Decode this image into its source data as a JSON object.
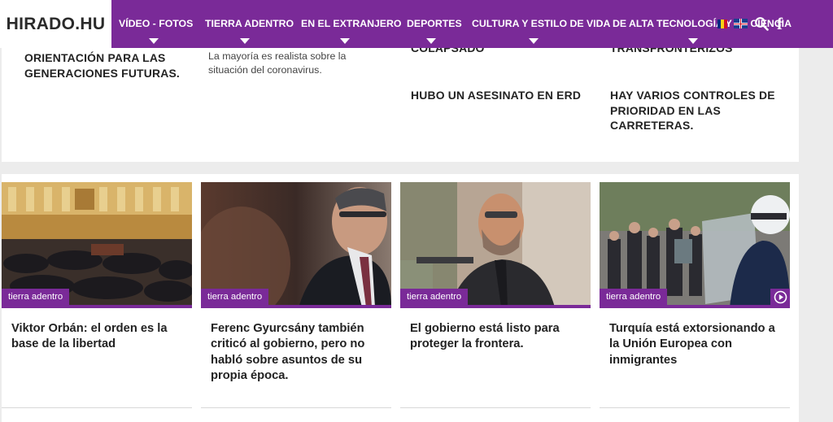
{
  "header": {
    "logo": "HIRADO.HU",
    "nav": [
      {
        "label": "VÍDEO - FOTOS"
      },
      {
        "label": "TIERRA ADENTRO"
      },
      {
        "label": "EN EL EXTRANJERO"
      },
      {
        "label": "DEPORTES"
      },
      {
        "label": "CULTURA Y ESTILO DE VIDA"
      },
      {
        "label": "DE ALTA TECNOLOGÍA Y LA CIENCIA"
      }
    ],
    "icons": [
      "flag-romania-icon",
      "flag-uk-icon",
      "search-icon",
      "facebook-icon"
    ],
    "colors": {
      "brand": "#7a2a98",
      "logo_bg": "#ffffff"
    }
  },
  "top": {
    "col1_title": "ORIENTACIÓN PARA LAS GENERACIONES FUTURAS.",
    "col2_sub": "La mayoría es realista sobre la situación del coronavirus.",
    "col3_cut": "COLAPSADO",
    "col3_title": "HUBO UN ASESINATO EN ERD",
    "col4_cut": "TRANSFRONTERIZOS",
    "col4_title": "HAY VARIOS CONTROLES DE PRIORIDAD EN LAS CARRETERAS."
  },
  "cards": [
    {
      "tag": "tierra adentro",
      "title": "Viktor Orbán: el orden es la base de la libertad",
      "image": "parliament-photo"
    },
    {
      "tag": "tierra adentro",
      "title": "Ferenc Gyurcsány también criticó al gobierno, pero no habló sobre asuntos de su propia época.",
      "image": "portrait-photo"
    },
    {
      "tag": "tierra adentro",
      "title": "El gobierno está listo para proteger la frontera.",
      "image": "speaker-photo"
    },
    {
      "tag": "tierra adentro",
      "title": "Turquía está extorsionando a la Unión Europea con inmigrantes",
      "image": "border-police-photo",
      "has_video": true
    }
  ]
}
